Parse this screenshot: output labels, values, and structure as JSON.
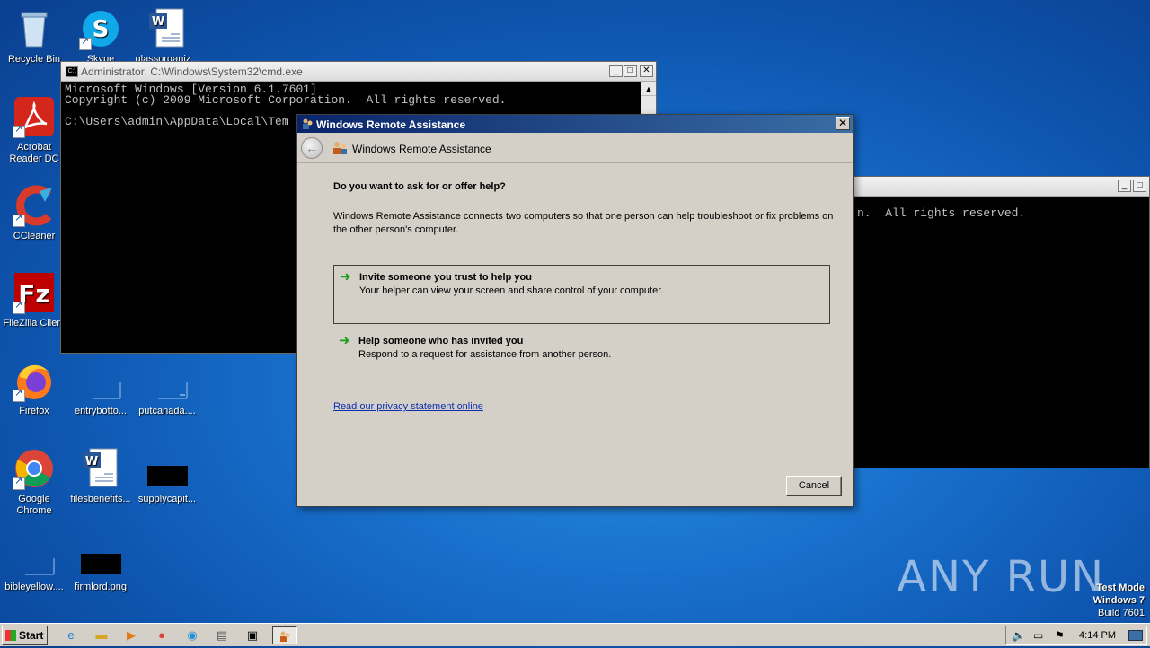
{
  "desktop": {
    "icons": [
      {
        "label": "Recycle Bin"
      },
      {
        "label": "Skype"
      },
      {
        "label": "glassorganiz..."
      },
      {
        "label": "Acrobat Reader DC"
      },
      {
        "label": "CCleaner"
      },
      {
        "label": "FileZilla Client"
      },
      {
        "label": "Firefox"
      },
      {
        "label": "entrybotto..."
      },
      {
        "label": "putcanada...."
      },
      {
        "label": "Google Chrome"
      },
      {
        "label": "filesbenefits..."
      },
      {
        "label": "supplycapit..."
      },
      {
        "label": "bibleyellow...."
      },
      {
        "label": "firmlord.png"
      }
    ]
  },
  "cmd_window": {
    "title": "Administrator: C:\\Windows\\System32\\cmd.exe",
    "lines": [
      "Microsoft Windows [Version 6.1.7601]",
      "Copyright (c) 2009 Microsoft Corporation.  All rights reserved.",
      "",
      "C:\\Users\\admin\\AppData\\Local\\Tem"
    ]
  },
  "cmd_window_2": {
    "text": "n.  All rights reserved."
  },
  "dialog": {
    "title": "Windows Remote Assistance",
    "header": "Windows Remote Assistance",
    "question": "Do you want to ask for or offer help?",
    "description": "Windows Remote Assistance connects two computers so that one person can help troubleshoot or fix problems on the other person's computer.",
    "options": [
      {
        "title": "Invite someone you trust to help you",
        "description": "Your helper can view your screen and share control of your computer."
      },
      {
        "title": "Help someone who has invited you",
        "description": "Respond to a request for assistance from another person."
      }
    ],
    "privacy_link": "Read our privacy statement online",
    "cancel_label": "Cancel"
  },
  "taskbar": {
    "start_label": "Start",
    "clock": "4:14 PM"
  },
  "watermark": "ANY RUN",
  "test_mode": {
    "line1": "Test Mode",
    "line2": "Windows 7",
    "line3": "Build 7601"
  }
}
